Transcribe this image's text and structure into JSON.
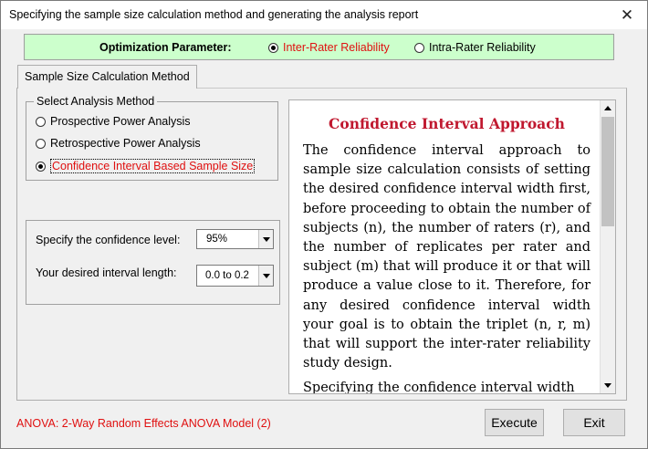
{
  "window": {
    "title": "Specifying the sample size calculation method and generating the analysis report",
    "close_glyph": "✕"
  },
  "optimization": {
    "label": "Optimization Parameter:",
    "options": [
      {
        "label": "Inter-Rater Reliability",
        "selected": true
      },
      {
        "label": "Intra-Rater Reliability",
        "selected": false
      }
    ]
  },
  "tab": {
    "label": "Sample Size Calculation Method"
  },
  "analysis_method": {
    "group_title": "Select Analysis Method",
    "options": [
      {
        "label": "Prospective Power Analysis",
        "selected": false
      },
      {
        "label": "Retrospective Power Analysis",
        "selected": false
      },
      {
        "label": "Confidence Interval Based Sample Size",
        "selected": true
      }
    ]
  },
  "confidence": {
    "level_label": "Specify the confidence level:",
    "level_value": "95%",
    "length_label": "Your desired interval length:",
    "length_value": "0.0 to 0.2"
  },
  "document": {
    "title": "Confidence Interval Approach",
    "paragraph": "The confidence interval approach to sample size calculation consists of setting the desired confidence interval width first, before proceeding to obtain the number of subjects (n), the number of raters (r), and the number of replicates per rater and subject (m) that will produce it or that will produce a value close to it. Therefore, for any desired confidence interval width your goal is to obtain the triplet (n, r, m) that will support the inter-rater reliability study design.",
    "paragraph2": "Specifying the confidence interval width"
  },
  "status": {
    "text": "ANOVA: 2-Way Random Effects ANOVA Model (2)"
  },
  "buttons": {
    "execute": "Execute",
    "exit": "Exit"
  },
  "colors": {
    "accent_red": "#e01010",
    "opt_bar_bg": "#ccffcc",
    "doc_title": "#c0182f"
  }
}
